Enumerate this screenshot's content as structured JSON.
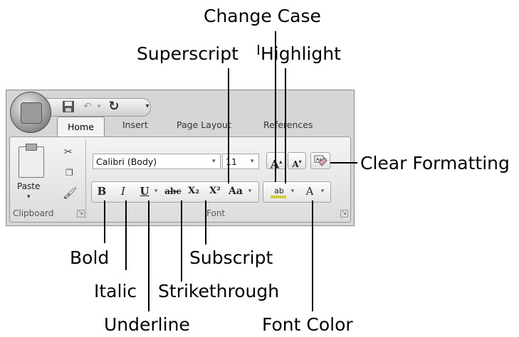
{
  "qat": {
    "title_caret": "▾"
  },
  "tabs": [
    "Home",
    "Insert",
    "Page Layout",
    "References"
  ],
  "clipboard": {
    "paste_label": "Paste",
    "group_label": "Clipboard"
  },
  "font": {
    "name_value": "Calibri (Body)",
    "size_value": "11",
    "group_label": "Font",
    "bold": "B",
    "italic": "I",
    "underline": "U",
    "strike": "abc",
    "subscript": "X₂",
    "superscript": "X²",
    "change_case": "Aa",
    "highlight": "ab",
    "font_color": "A",
    "grow": "A",
    "shrink": "A"
  },
  "callouts": {
    "change_case": "Change Case",
    "superscript": "Superscript",
    "highlight": "Highlight",
    "clear_formatting": "Clear Formatting",
    "bold": "Bold",
    "italic": "Italic",
    "underline": "Underline",
    "strikethrough": "Strikethrough",
    "subscript": "Subscript",
    "font_color": "Font Color"
  }
}
